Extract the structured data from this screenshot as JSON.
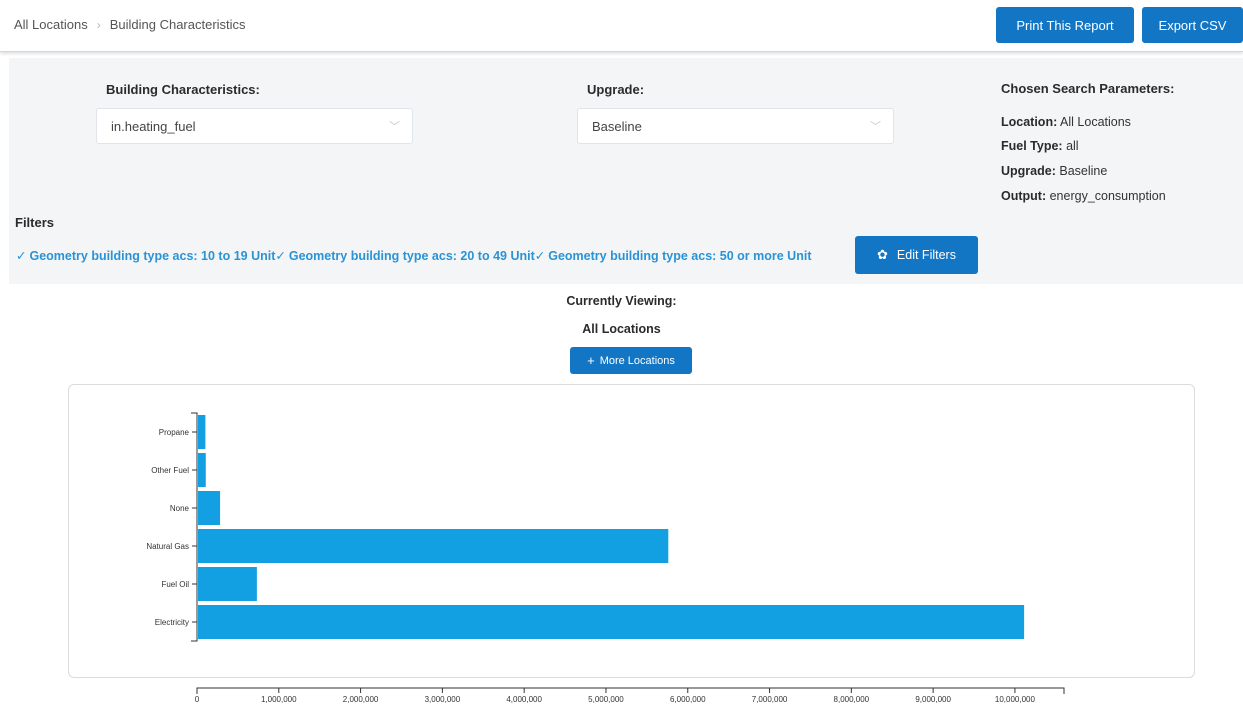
{
  "breadcrumb": {
    "root": "All Locations",
    "current": "Building Characteristics"
  },
  "header": {
    "print_label": "Print This Report",
    "export_label": "Export CSV"
  },
  "controls": {
    "building_label": "Building Characteristics:",
    "building_value": "in.heating_fuel",
    "upgrade_label": "Upgrade:",
    "upgrade_value": "Baseline"
  },
  "params": {
    "title": "Chosen Search Parameters:",
    "location_key": "Location:",
    "location_val": "All Locations",
    "fuel_key": "Fuel Type:",
    "fuel_val": "all",
    "upgrade_key": "Upgrade:",
    "upgrade_val": "Baseline",
    "output_key": "Output:",
    "output_val": "energy_consumption"
  },
  "filters": {
    "title": "Filters",
    "chips": [
      "Geometry building type acs: 10 to 19 Unit",
      "Geometry building type acs: 20 to 49 Unit",
      "Geometry building type acs: 50 or more Unit"
    ],
    "check_glyph": "✓",
    "edit_label": "Edit Filters"
  },
  "viewing": {
    "title": "Currently Viewing:",
    "location": "All Locations",
    "more_label": "More Locations"
  },
  "colors": {
    "accent": "#1376c5",
    "bar": "#13a0e2",
    "link": "#2a93d5"
  },
  "chart_data": {
    "type": "bar",
    "orientation": "horizontal",
    "categories": [
      "Propane",
      "Other Fuel",
      "None",
      "Natural Gas",
      "Fuel Oil",
      "Electricity"
    ],
    "values": [
      90000,
      95000,
      270000,
      5750000,
      720000,
      10100000
    ],
    "xlim": [
      0,
      10600000
    ],
    "x_ticks": [
      0,
      1000000,
      2000000,
      3000000,
      4000000,
      5000000,
      6000000,
      7000000,
      8000000,
      9000000,
      10000000
    ],
    "x_tick_labels": [
      "0",
      "1,000,000",
      "2,000,000",
      "3,000,000",
      "4,000,000",
      "5,000,000",
      "6,000,000",
      "7,000,000",
      "8,000,000",
      "9,000,000",
      "10,000,000"
    ],
    "grid": false
  }
}
